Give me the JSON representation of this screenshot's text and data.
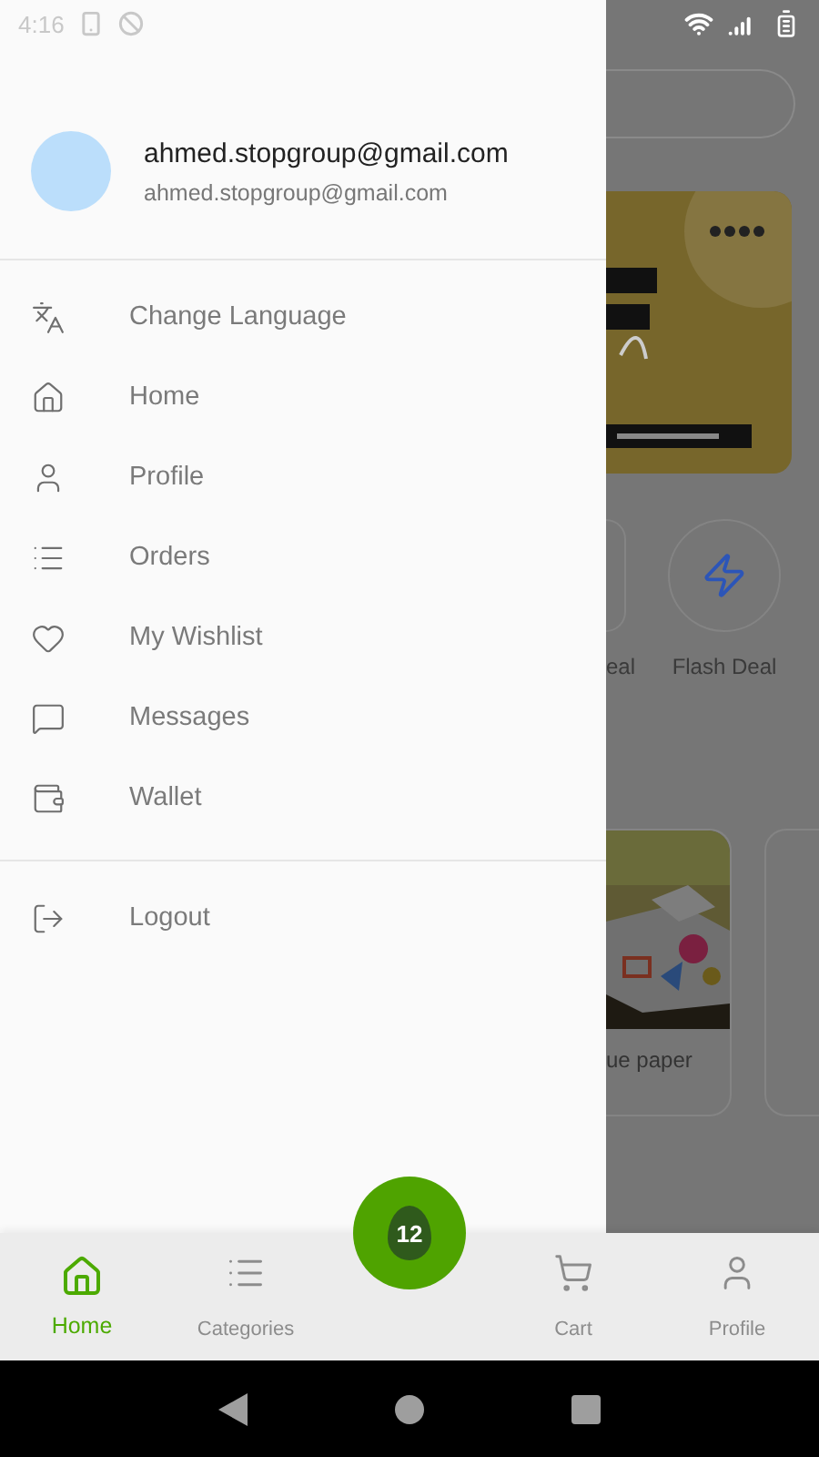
{
  "status_bar": {
    "time": "4:16"
  },
  "drawer": {
    "account": {
      "name": "ahmed.stopgroup@gmail.com",
      "email": "ahmed.stopgroup@gmail.com"
    },
    "menu": [
      {
        "label": "Change Language",
        "kind": "language"
      },
      {
        "label": "Home",
        "kind": "home"
      },
      {
        "label": "Profile",
        "kind": "user"
      },
      {
        "label": "Orders",
        "kind": "list"
      },
      {
        "label": "My Wishlist",
        "kind": "heart"
      },
      {
        "label": "Messages",
        "kind": "message"
      },
      {
        "label": "Wallet",
        "kind": "wallet"
      }
    ],
    "footer_menu": [
      {
        "label": "Logout",
        "kind": "logout"
      }
    ]
  },
  "background_page": {
    "deals": [
      {
        "label": "eal",
        "kind": "partial"
      },
      {
        "label": "Flash Deal",
        "kind": "flash"
      }
    ],
    "products": [
      {
        "name": "ue paper"
      }
    ]
  },
  "bottom_nav": {
    "items": [
      {
        "label": "Home",
        "kind": "home",
        "selected": true
      },
      {
        "label": "Categories",
        "kind": "list",
        "selected": false
      },
      {
        "label": "Cart",
        "kind": "cart",
        "selected": false
      },
      {
        "label": "Profile",
        "kind": "user",
        "selected": false
      }
    ],
    "center_logo": {
      "text": "12"
    }
  }
}
